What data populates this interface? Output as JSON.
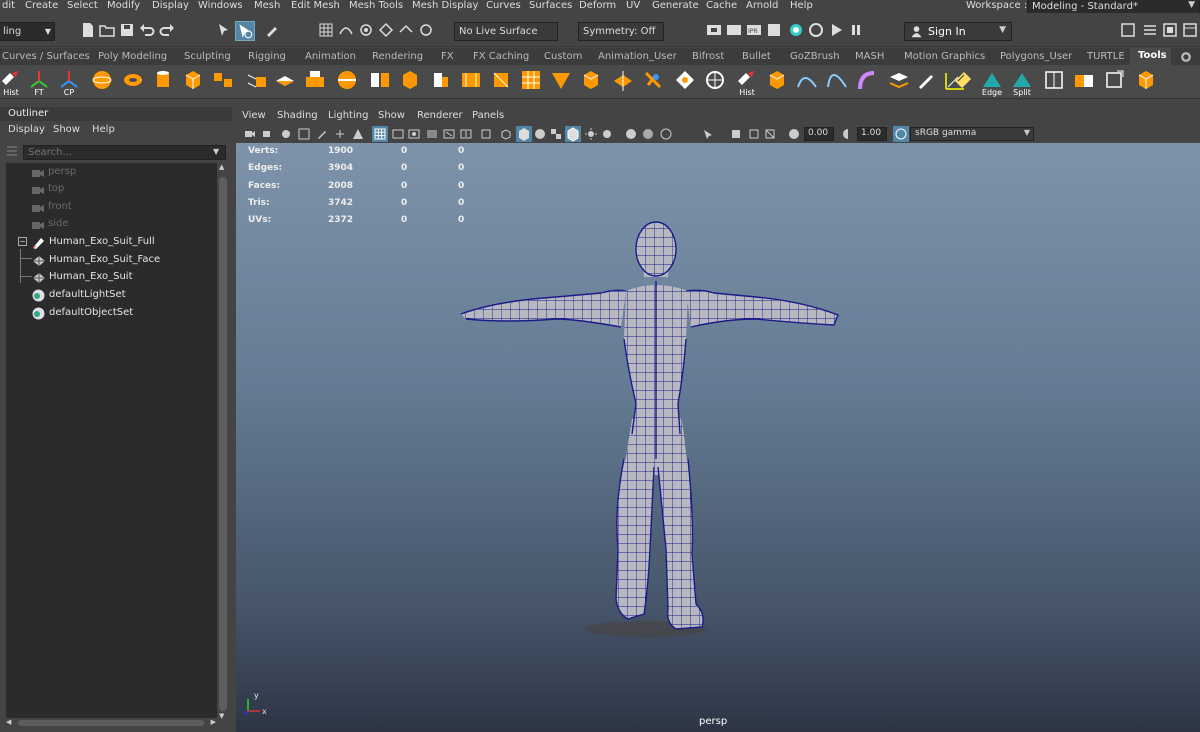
{
  "menubar": {
    "items": [
      "dit",
      "Create",
      "Select",
      "Modify",
      "Display",
      "Windows",
      "Mesh",
      "Edit Mesh",
      "Mesh Tools",
      "Mesh Display",
      "Curves",
      "Surfaces",
      "Deform",
      "UV",
      "Generate",
      "Cache",
      "Arnold",
      "Help"
    ],
    "workspace_label": "Workspace :",
    "workspace_value": "Modeling - Standard*"
  },
  "statusline": {
    "mode_value": "ling",
    "live_surface": "No Live Surface",
    "symmetry": "Symmetry: Off",
    "sign_in": "Sign In"
  },
  "shelf_tabs": [
    "Curves / Surfaces",
    "Poly Modeling",
    "Sculpting",
    "Rigging",
    "Animation",
    "Rendering",
    "FX",
    "FX Caching",
    "Custom",
    "Animation_User",
    "Bifrost",
    "Bullet",
    "GoZBrush",
    "MASH",
    "Motion Graphics",
    "Polygons_User",
    "TURTLE",
    "Tools"
  ],
  "shelf_labels": {
    "hist": "Hist",
    "ft": "FT",
    "cp": "CP",
    "hist2": "Hist",
    "edge": "Edge",
    "split": "Split"
  },
  "outliner": {
    "title": "Outliner",
    "menu": [
      "Display",
      "Show",
      "Help"
    ],
    "search_placeholder": "Search...",
    "items": [
      {
        "label": "persp",
        "dim": true
      },
      {
        "label": "top",
        "dim": true
      },
      {
        "label": "front",
        "dim": true
      },
      {
        "label": "side",
        "dim": true
      },
      {
        "label": "Human_Exo_Suit_Full",
        "dim": false
      },
      {
        "label": "Human_Exo_Suit_Face",
        "dim": false
      },
      {
        "label": "Human_Exo_Suit",
        "dim": false
      },
      {
        "label": "defaultLightSet",
        "dim": false
      },
      {
        "label": "defaultObjectSet",
        "dim": false
      }
    ]
  },
  "viewport": {
    "menu": [
      "View",
      "Shading",
      "Lighting",
      "Show",
      "Renderer",
      "Panels"
    ],
    "exposure": "0.00",
    "gamma": "1.00",
    "colorspace": "sRGB gamma",
    "camera_label": "persp",
    "axis_y": "y",
    "axis_x": "x",
    "hud": [
      {
        "label": "Verts:",
        "v1": "1900",
        "v2": "0",
        "v3": "0"
      },
      {
        "label": "Edges:",
        "v1": "3904",
        "v2": "0",
        "v3": "0"
      },
      {
        "label": "Faces:",
        "v1": "2008",
        "v2": "0",
        "v3": "0"
      },
      {
        "label": "Tris:",
        "v1": "3742",
        "v2": "0",
        "v3": "0"
      },
      {
        "label": "UVs:",
        "v1": "2372",
        "v2": "0",
        "v3": "0"
      }
    ]
  },
  "colors": {
    "accent": "#5285a6",
    "selected_tool": "#5285a6",
    "wire": "#1a1a8c",
    "mesh": "#b8b8c0"
  }
}
